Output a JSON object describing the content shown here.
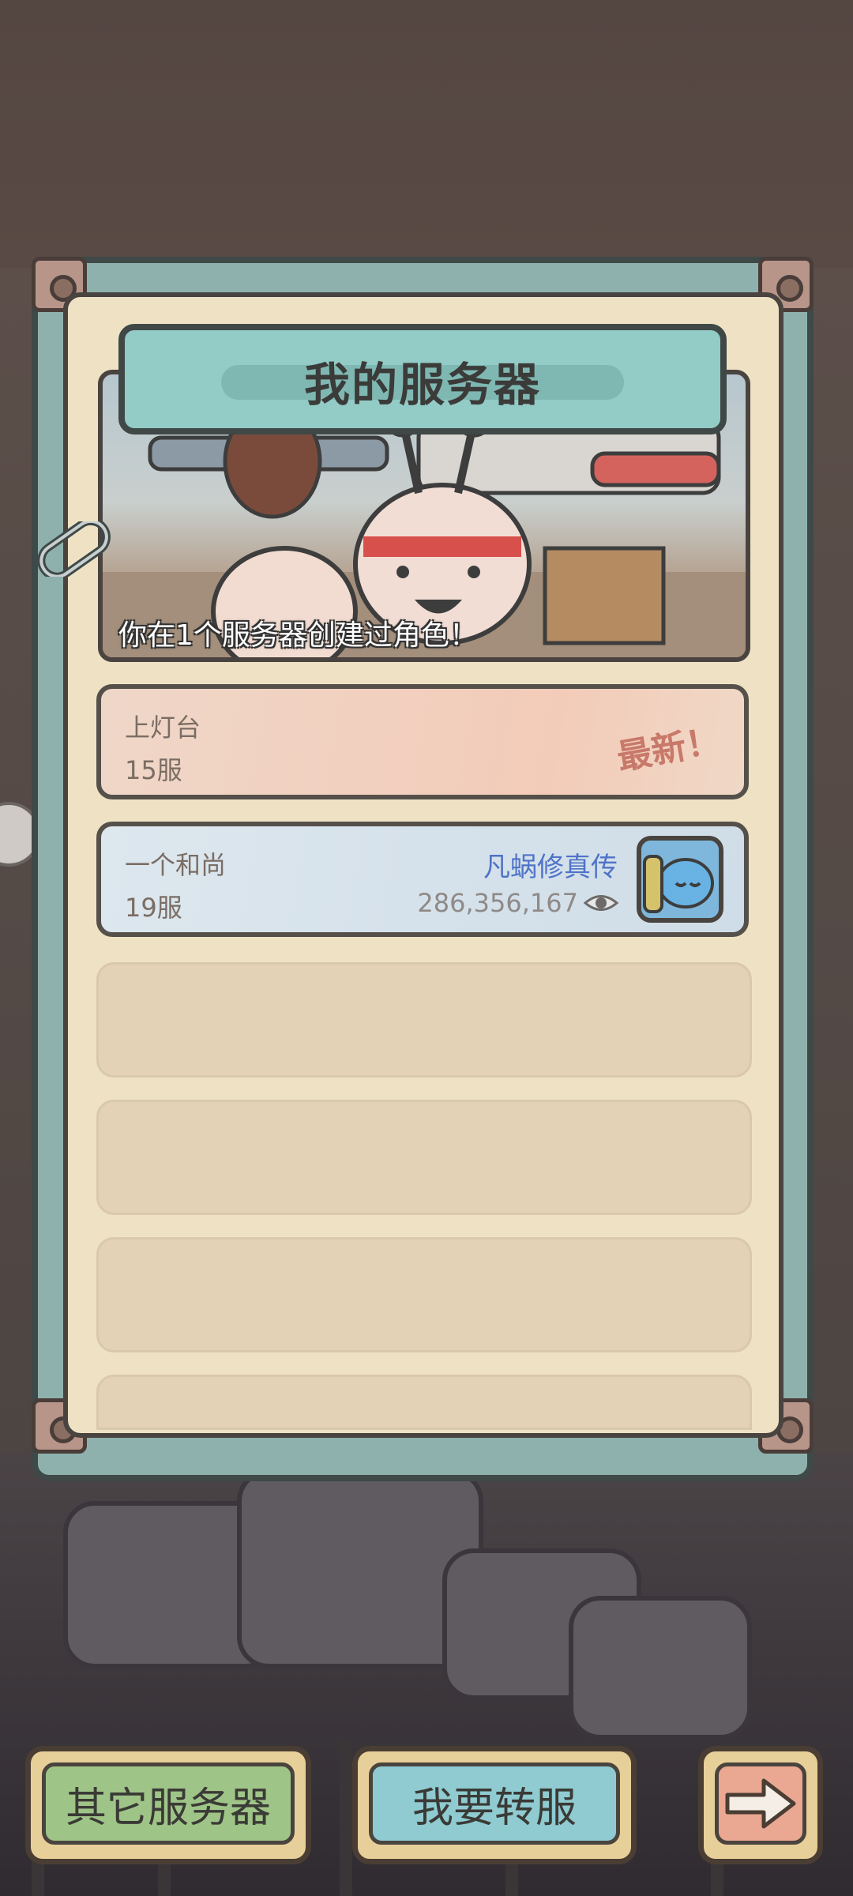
{
  "dialog": {
    "title": "我的服务器",
    "caption": "你在1个服务器创建过角色！"
  },
  "servers": [
    {
      "name": "上灯台",
      "server": "15服",
      "badge": "最新！"
    },
    {
      "name": "一个和尚",
      "server": "19服",
      "character": "凡蜗修真传",
      "power": "286,356,167"
    }
  ],
  "buttons": {
    "other_servers": "其它服务器",
    "transfer": "我要转服"
  },
  "icons": {
    "next": "right-arrow-icon",
    "view": "eye-icon",
    "attach": "paperclip-icon"
  },
  "colors": {
    "frame": "#8fb1ad",
    "panel": "#efe2c4",
    "badge": "#c8796a",
    "character_name": "#4f73c8"
  }
}
